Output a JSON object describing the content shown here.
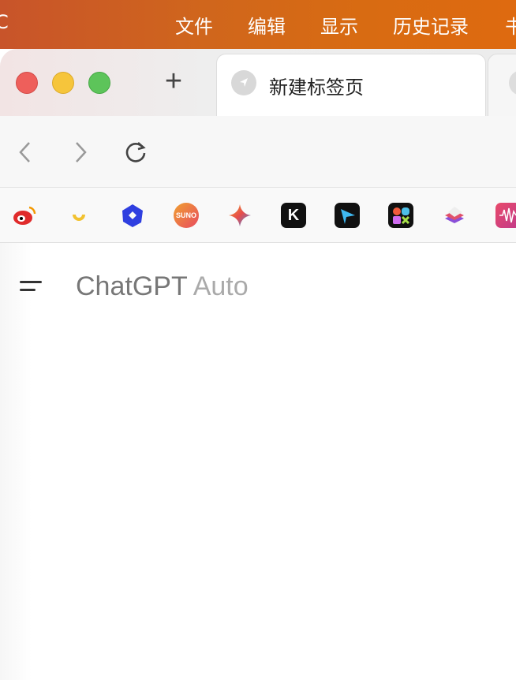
{
  "menubar": {
    "app_partial": "C",
    "items": [
      "文件",
      "编辑",
      "显示",
      "历史记录",
      "书"
    ]
  },
  "tabs": {
    "active_title": "新建标签页"
  },
  "bookmarks": [
    "weibo",
    "yuanbao",
    "qwen",
    "suno",
    "gemini",
    "kimi",
    "tiangong",
    "apps",
    "stack",
    "audio"
  ],
  "bookmark_labels": {
    "suno": "SUNO",
    "kimi": "K"
  },
  "content": {
    "model_name": "ChatGPT",
    "model_variant": "Auto"
  }
}
